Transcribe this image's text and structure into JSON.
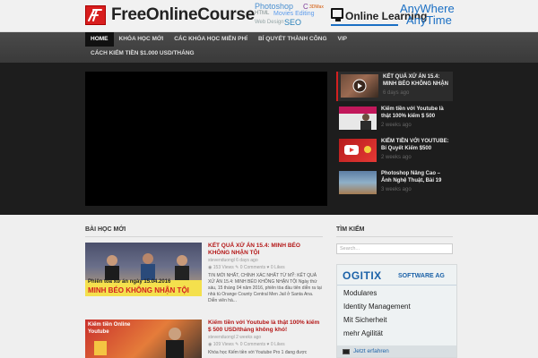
{
  "header": {
    "logo_text": "FreeOnlineCourse",
    "banner_words": [
      "Photoshop",
      "C",
      "3DMax",
      "HTML",
      "Movies Editing",
      "Web Design",
      "SEO"
    ],
    "brand_text": "Online Learning",
    "tagline_line1": "AnyWhere",
    "tagline_line2": "AnyTime"
  },
  "nav": {
    "items": [
      {
        "label": "HOME"
      },
      {
        "label": "KHÓA HỌC MỚI"
      },
      {
        "label": "CÁC KHÓA HỌC MIỄN PHÍ"
      },
      {
        "label": "BÍ QUYẾT THÀNH CÔNG"
      },
      {
        "label": "VIP"
      }
    ],
    "second_row": "CÁCH KIẾM TIỀN $1.000 USD/THÁNG"
  },
  "slider": {
    "items": [
      {
        "title": "KẾT QUẢ XỬ ÁN 15.4: MINH BÉO KHÔNG NHẬN",
        "date": "6 days ago"
      },
      {
        "title": "Kiếm tiền với Youtube là thật 100% kiếm $ 500",
        "date": "2 weeks ago"
      },
      {
        "title": "KIẾM TIỀN VỚI YOUTUBE: Bí Quyết Kiếm $500",
        "date": "2 weeks ago"
      },
      {
        "title": "Photoshop Nâng Cao – Ảnh Nghệ Thuật, Bài 19",
        "date": "3 weeks ago"
      }
    ]
  },
  "main": {
    "section_title": "BÀI HỌC MỚI",
    "posts": [
      {
        "title": "KẾT QUẢ XỬ ÁN 15.4: MINH BÉO KHÔNG NHẬN TỘI",
        "author": "stevenduongl",
        "date": "6 days ago",
        "views": "153 Views",
        "comments": "0 Comments",
        "likes": "0 Likes",
        "excerpt": "TIN MỚI NHẤT, CHÍNH XÁC NHẤT TỪ MỸ: KẾT QUẢ XỬ ÁN 15.4: MINH BÉO KHÔNG NHẬN TỘI Ngày thứ sáu, 15 tháng 04 năm 2016, phiên tòa đầu tiên diễn ra tại nhà tù Orange County Central Men Jail ở Santa Ana. Diễn viên hà...",
        "image_caption1": "Phiên tòa xử án ngày 15.04.2016",
        "image_caption2": "MINH BÉO KHÔNG NHẬN TỘI"
      },
      {
        "title": "Kiếm tiền với Youtube là thật 100% kiếm $ 500 USD/tháng không khó!",
        "author": "stevenduongl",
        "date": "2 weeks ago",
        "views": "109 Views",
        "comments": "0 Comments",
        "likes": "0 Likes",
        "excerpt": "Khóa học Kiếm tiền với Youtube Pro 1 đang được",
        "image_caption1": "Kiếm tiền Online",
        "image_caption2": "Youtube"
      }
    ]
  },
  "sidebar": {
    "search_title": "TÌM KIẾM",
    "search_placeholder": "Search...",
    "ad": {
      "logo": "OGITIX",
      "company": "SOFTWARE AG",
      "lines": [
        "Modulares",
        "Identity Management",
        "Mit Sicherheit",
        "mehr Agilität"
      ],
      "footer": "Jetzt erfahren"
    }
  },
  "colors": {
    "accent_red": "#d32020",
    "nav_bg": "#3f3f3f",
    "hero_bg": "#1d1d1d",
    "link_blue": "#1a6fc4"
  }
}
